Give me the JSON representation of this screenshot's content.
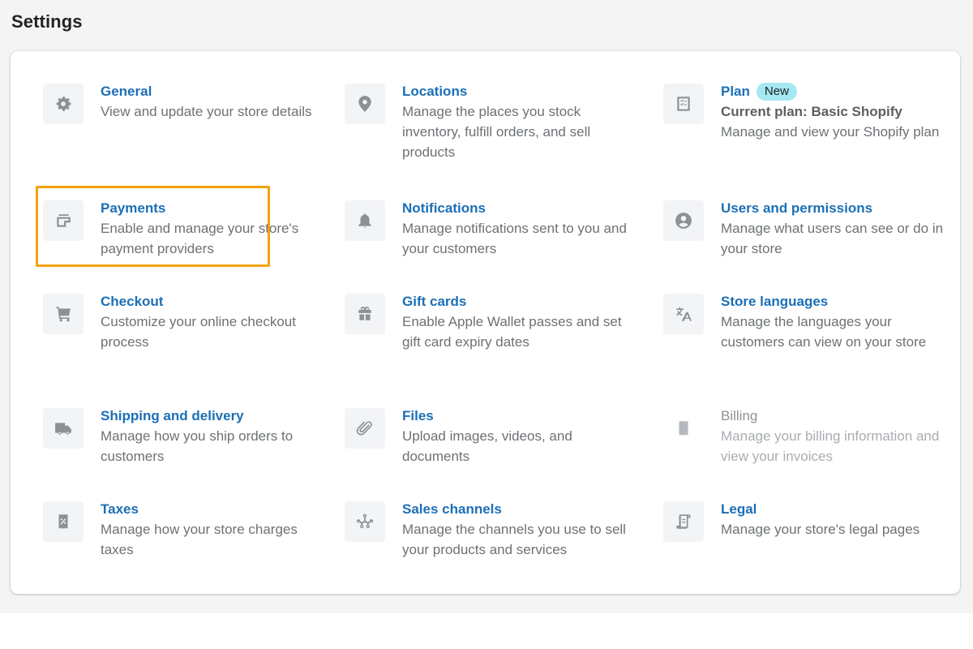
{
  "page": {
    "title": "Settings"
  },
  "highlight_color": "#f2a20c",
  "link_color": "#1c6fb6",
  "items": [
    {
      "id": "general",
      "icon": "gear-icon",
      "title": "General",
      "description": "View and update your store details"
    },
    {
      "id": "locations",
      "icon": "location-pin-icon",
      "title": "Locations",
      "description": "Manage the places you stock inventory, fulfill orders, and sell products"
    },
    {
      "id": "plan",
      "icon": "checklist-icon",
      "title": "Plan",
      "badge": "New",
      "subtitle": "Current plan: Basic Shopify",
      "description": "Manage and view your Shopify plan"
    },
    {
      "id": "payments",
      "icon": "payment-card-icon",
      "title": "Payments",
      "description": "Enable and manage your store's payment providers",
      "highlighted": true
    },
    {
      "id": "notifications",
      "icon": "bell-icon",
      "title": "Notifications",
      "description": "Manage notifications sent to you and your customers"
    },
    {
      "id": "users",
      "icon": "user-circle-icon",
      "title": "Users and permissions",
      "description": "Manage what users can see or do in your store"
    },
    {
      "id": "checkout",
      "icon": "cart-icon",
      "title": "Checkout",
      "description": "Customize your online checkout process"
    },
    {
      "id": "gift-cards",
      "icon": "gift-icon",
      "title": "Gift cards",
      "description": "Enable Apple Wallet passes and set gift card expiry dates"
    },
    {
      "id": "languages",
      "icon": "translate-icon",
      "title": "Store languages",
      "description": "Manage the languages your customers can view on your store"
    },
    {
      "id": "shipping",
      "icon": "truck-icon",
      "title": "Shipping and delivery",
      "description": "Manage how you ship orders to customers"
    },
    {
      "id": "files",
      "icon": "paperclip-icon",
      "title": "Files",
      "description": "Upload images, videos, and documents"
    },
    {
      "id": "billing",
      "icon": "receipt-dollar-icon",
      "title": "Billing",
      "description": "Manage your billing information and view your invoices",
      "disabled": true
    },
    {
      "id": "taxes",
      "icon": "receipt-percent-icon",
      "title": "Taxes",
      "description": "Manage how your store charges taxes"
    },
    {
      "id": "sales-channels",
      "icon": "channels-icon",
      "title": "Sales channels",
      "description": "Manage the channels you use to sell your products and services"
    },
    {
      "id": "legal",
      "icon": "scroll-icon",
      "title": "Legal",
      "description": "Manage your store's legal pages"
    }
  ]
}
